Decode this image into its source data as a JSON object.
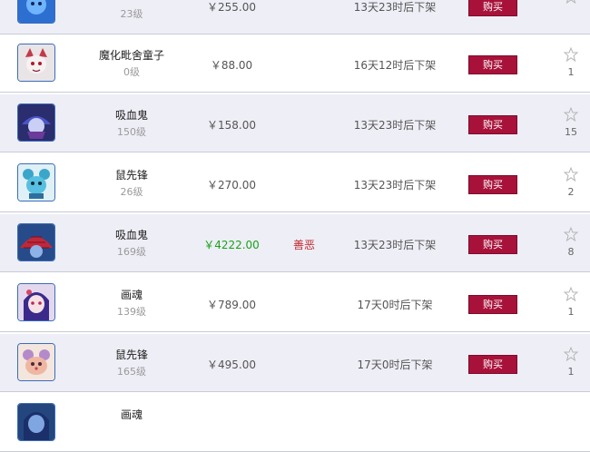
{
  "buy_label": "购买",
  "rows": [
    {
      "name": "",
      "level": "23级",
      "price": "￥255.00",
      "price_color": "#555555",
      "tag": "",
      "expire": "13天23时后下架",
      "favorites": ""
    },
    {
      "name": "魔化毗舍童子",
      "level": "0级",
      "price": "￥88.00",
      "price_color": "#555555",
      "tag": "",
      "expire": "16天12时后下架",
      "favorites": "1"
    },
    {
      "name": "吸血鬼",
      "level": "150级",
      "price": "￥158.00",
      "price_color": "#555555",
      "tag": "",
      "expire": "13天23时后下架",
      "favorites": "15"
    },
    {
      "name": "鼠先锋",
      "level": "26级",
      "price": "￥270.00",
      "price_color": "#555555",
      "tag": "",
      "expire": "13天23时后下架",
      "favorites": "2"
    },
    {
      "name": "吸血鬼",
      "level": "169级",
      "price": "￥4222.00",
      "price_color": "#19a319",
      "tag": "善恶",
      "expire": "13天23时后下架",
      "favorites": "8"
    },
    {
      "name": "画魂",
      "level": "139级",
      "price": "￥789.00",
      "price_color": "#555555",
      "tag": "",
      "expire": "17天0时后下架",
      "favorites": "1"
    },
    {
      "name": "鼠先锋",
      "level": "165级",
      "price": "￥495.00",
      "price_color": "#555555",
      "tag": "",
      "expire": "17天0时后下架",
      "favorites": "1"
    },
    {
      "name": "画魂",
      "level": "",
      "price": "",
      "price_color": "#555555",
      "tag": "",
      "expire": "",
      "favorites": ""
    }
  ]
}
